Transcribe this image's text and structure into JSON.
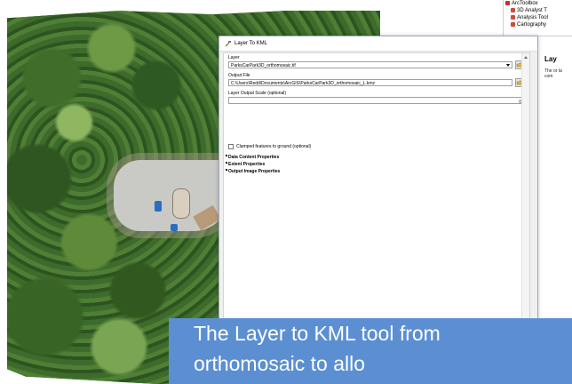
{
  "toolbox": {
    "title": "ArcToolbox",
    "items": [
      "3D Analyst T",
      "Analysis Tool",
      "Cartography"
    ]
  },
  "dialog": {
    "title": "Layer To KML",
    "layer_label": "Layer",
    "layer_value": "ParksCarPark3D_orthomosaic.tif",
    "output_label": "Output File",
    "output_value": "C:\\Users\\Redd\\Documents\\ArcGIS\\ParksCarPark3D_orthomosaic_L.kmz",
    "scale_label": "Layer Output Scale (optional)",
    "scale_value": "0",
    "clamp_label": "Clamped features to ground (optional)",
    "sections": [
      "Data Content Properties",
      "Extent Properties",
      "Output Image Properties"
    ]
  },
  "help": {
    "title": "Lay",
    "text": "The or la com"
  },
  "caption": {
    "line1": "The Layer to KML tool from",
    "line2": "orthomosaic to allo"
  },
  "colors": {
    "caption_bg": "#5b8fd2",
    "dialog_bg": "#f0f0f0",
    "toolbox_icon": "#c9302c"
  }
}
